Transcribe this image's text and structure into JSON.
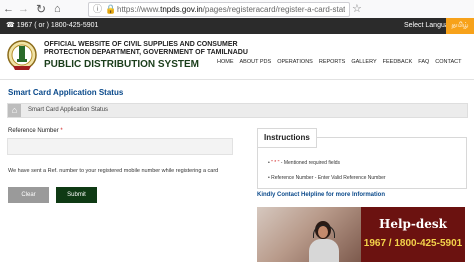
{
  "browser": {
    "url_prefix": "https://www.",
    "url_domain": "tnpds.gov.in",
    "url_path": "/pages/registeracard/register-a-card-status.xhtml"
  },
  "top_strip": {
    "phone": "1967 ( or ) 1800-425-5901",
    "select_language": "Select Language",
    "tamil": "தமிழ்"
  },
  "header": {
    "org_line1": "OFFICIAL WEBSITE OF CIVIL SUPPLIES AND CONSUMER",
    "org_line2": "PROTECTION DEPARTMENT, GOVERNMENT OF TAMILNADU",
    "org_line3": "PUBLIC DISTRIBUTION SYSTEM",
    "nav": [
      "HOME",
      "ABOUT PDS",
      "OPERATIONS",
      "REPORTS",
      "GALLERY",
      "FEEDBACK",
      "FAQ",
      "CONTACT"
    ]
  },
  "page": {
    "title": "Smart Card Application Status",
    "breadcrumb": "Smart Card Application Status"
  },
  "form": {
    "reference_label": "Reference Number",
    "required_mark": "*",
    "reference_value": "",
    "info_text": "We have sent a Ref. number to your registered mobile number while registering a card",
    "clear_label": "Clear",
    "submit_label": "Submit"
  },
  "instructions": {
    "heading": "Instructions",
    "item1_star": "\" * \"",
    "item1_text": " - Mentioned required fields",
    "item2_text": "Reference Number - Enter Valid Reference Number",
    "helpline_link": "Kindly Contact Helpline for more Information"
  },
  "help_banner": {
    "title": "Help-desk",
    "number": "1967 / 1800-425-5901"
  },
  "colors": {
    "title_blue": "#0b4a8b",
    "submit_green": "#0f3a14",
    "helpdesk_red": "#6b1210",
    "tamil_orange": "#f7a21a"
  }
}
